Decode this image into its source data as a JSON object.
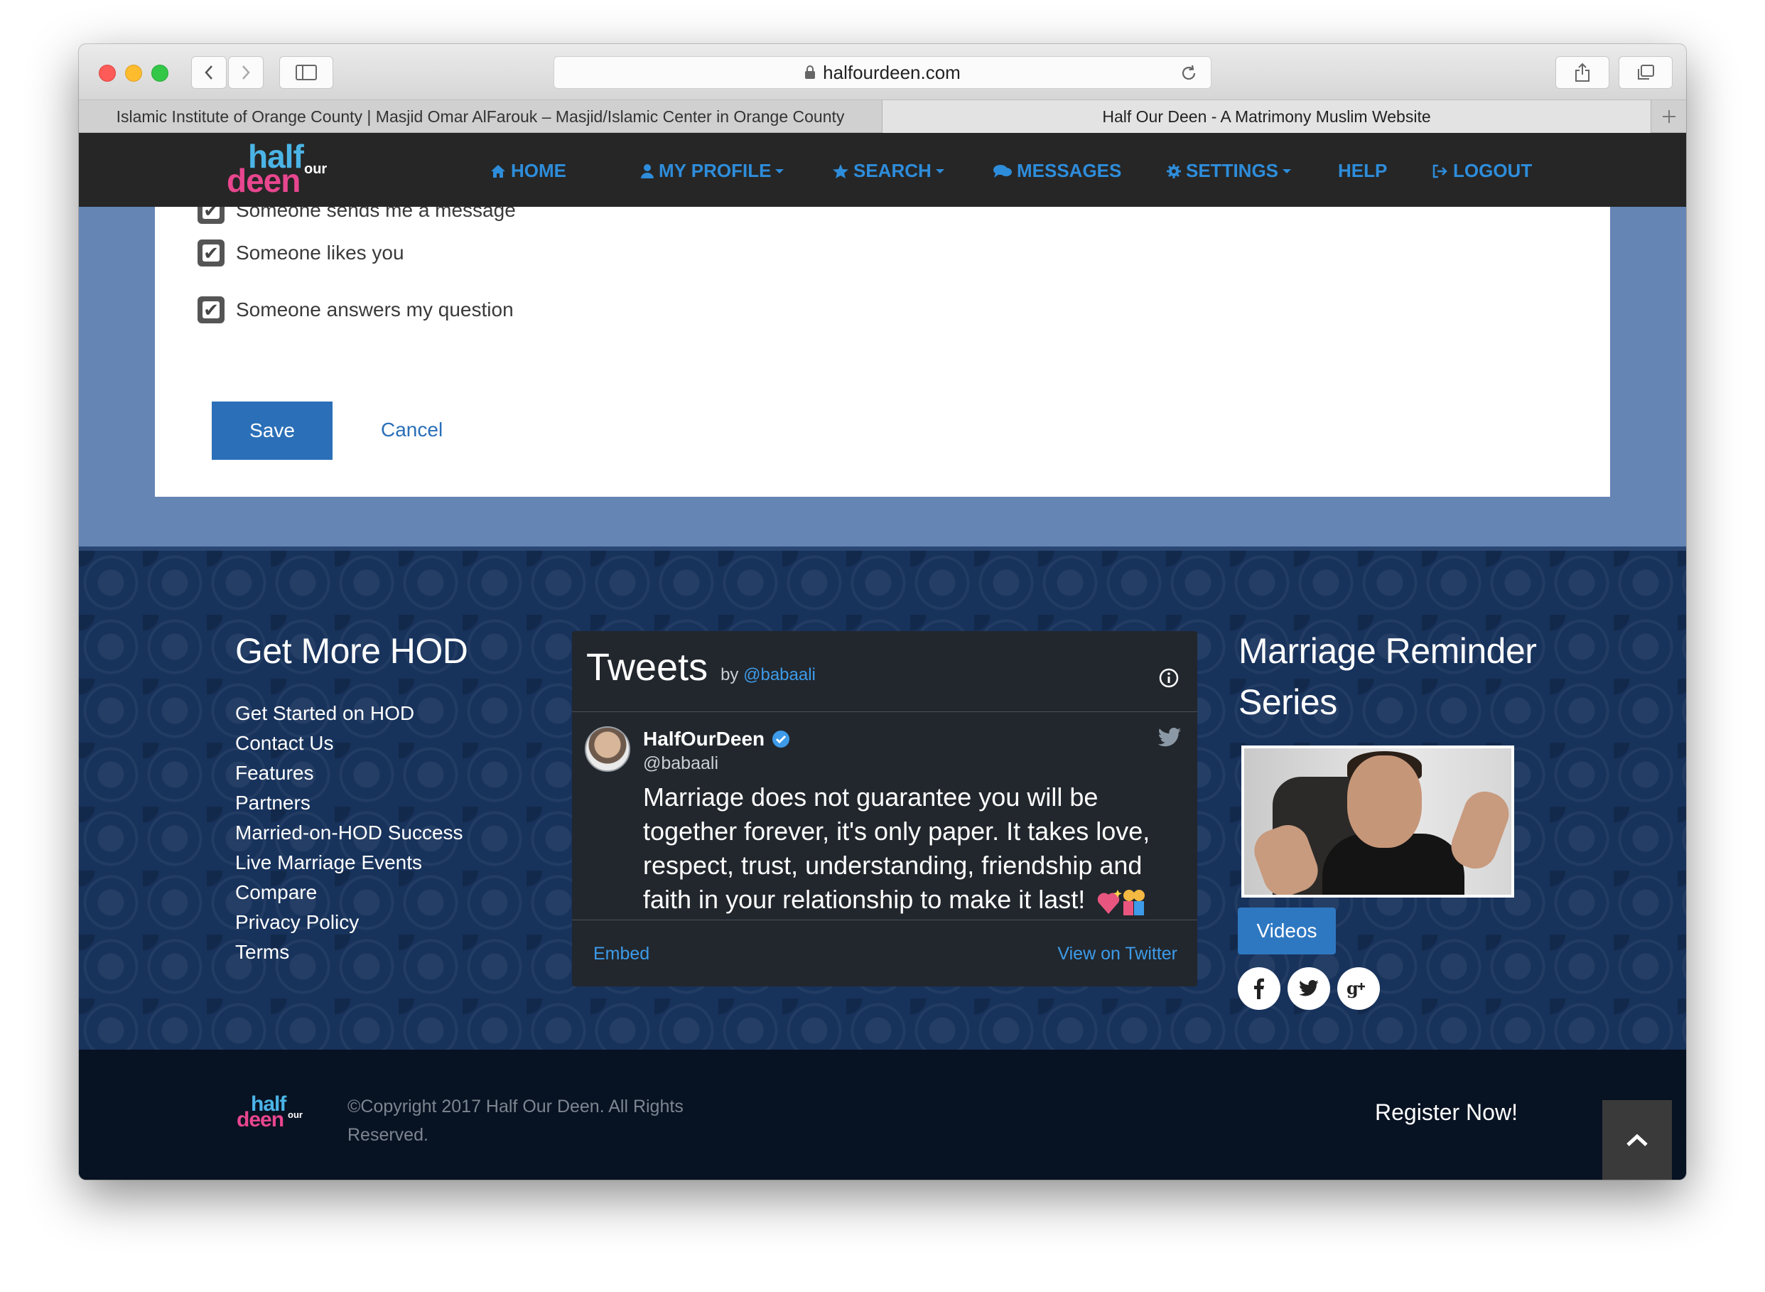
{
  "browser": {
    "url": "halfourdeen.com",
    "tabs": [
      {
        "label": "Islamic Institute of Orange County | Masjid Omar AlFarouk – Masjid/Islamic Center in Orange County"
      },
      {
        "label": "Half Our Deen - A Matrimony Muslim Website"
      }
    ]
  },
  "logo": {
    "half": "half",
    "deen": "deen",
    "our": "our"
  },
  "nav": {
    "home": "HOME",
    "my_profile": "MY PROFILE",
    "search": "SEARCH",
    "messages": "MESSAGES",
    "settings": "SETTINGS",
    "help": "HELP",
    "logout": "LOGOUT"
  },
  "settings_form": {
    "options": [
      {
        "label": "Someone sends me a message",
        "checked": true
      },
      {
        "label": "Someone likes you",
        "checked": true
      },
      {
        "label": "Someone answers my question",
        "checked": true
      }
    ],
    "save_label": "Save",
    "cancel_label": "Cancel"
  },
  "footer": {
    "get_more_title": "Get More HOD",
    "links": [
      "Get Started on HOD",
      "Contact Us",
      "Features",
      "Partners",
      "Married-on-HOD Success",
      "Live Marriage Events",
      "Compare",
      "Privacy Policy",
      "Terms"
    ],
    "tweets": {
      "title": "Tweets",
      "by": "by",
      "by_handle": "@babaali",
      "author_name": "HalfOurDeen",
      "author_handle": "@babaali",
      "text": "Marriage does not guarantee you will be together forever, it's only paper. It takes love, respect, trust, understanding, friendship and faith in your relationship to make it last!",
      "embed_label": "Embed",
      "view_label": "View on Twitter"
    },
    "marriage_title_line1": "Marriage Reminder",
    "marriage_title_line2": "Series",
    "videos_label": "Videos",
    "copyright": "©Copyright 2017 Half Our Deen. All Rights Reserved.",
    "register_label": "Register Now!"
  },
  "colors": {
    "nav_link": "#2e8ddb",
    "save_button": "#2a6fb8",
    "page_bg": "#6585b5",
    "footer_bg": "#17325b",
    "logo_blue": "#4bb4e6",
    "logo_pink": "#e8468f"
  }
}
